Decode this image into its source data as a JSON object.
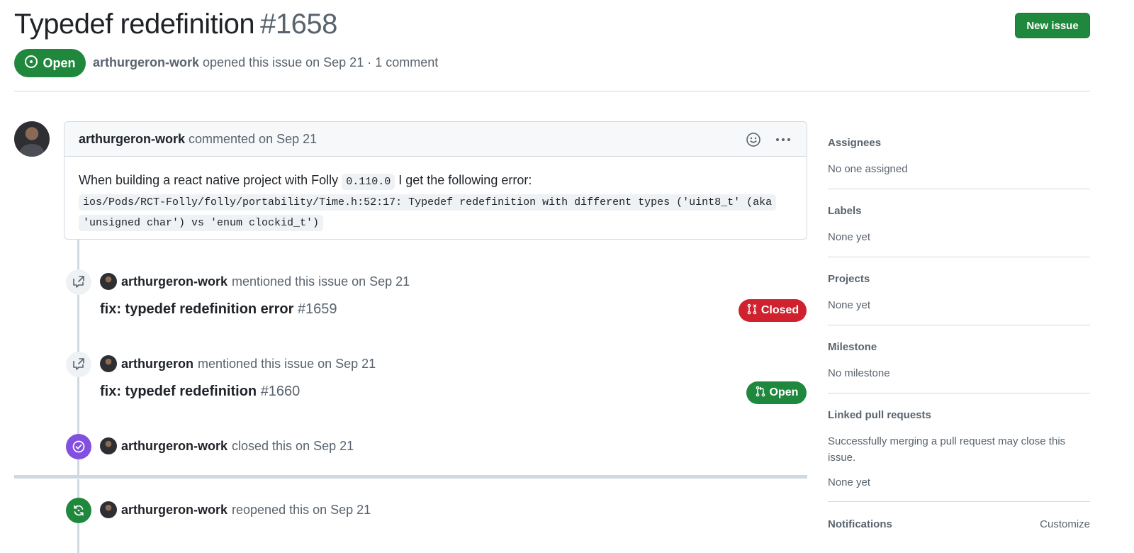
{
  "issue": {
    "title": "Typedef redefinition",
    "number": "#1658",
    "state": "Open",
    "author": "arthurgeron-work",
    "meta": "opened this issue on Sep 21 · 1 comment",
    "new_issue_label": "New issue"
  },
  "comment": {
    "author": "arthurgeron-work",
    "meta": "commented on Sep 21",
    "body_prefix": "When building a react native project with Folly",
    "body_version": "0.110.0",
    "body_suffix": "I get the following error:",
    "error_line1": "ios/Pods/RCT-Folly/folly/portability/Time.h:52:17: Typedef redefinition with different types ('uint8_t' (aka",
    "error_line2": "'unsigned char') vs 'enum clockid_t')"
  },
  "timeline": [
    {
      "actor": "arthurgeron-work",
      "action": "mentioned this issue on Sep 21",
      "ref_title": "fix: typedef redefinition error",
      "ref_number": "#1659",
      "ref_state": "Closed"
    },
    {
      "actor": "arthurgeron",
      "action": "mentioned this issue on Sep 21",
      "ref_title": "fix: typedef redefinition",
      "ref_number": "#1660",
      "ref_state": "Open"
    },
    {
      "actor": "arthurgeron-work",
      "action": "closed this on Sep 21"
    },
    {
      "actor": "arthurgeron-work",
      "action": "reopened this on Sep 21"
    }
  ],
  "sidebar": {
    "assignees": {
      "label": "Assignees",
      "value": "No one assigned"
    },
    "labels": {
      "label": "Labels",
      "value": "None yet"
    },
    "projects": {
      "label": "Projects",
      "value": "None yet"
    },
    "milestone": {
      "label": "Milestone",
      "value": "No milestone"
    },
    "linked_prs": {
      "label": "Linked pull requests",
      "description": "Successfully merging a pull request may close this issue.",
      "value": "None yet"
    },
    "notifications": {
      "label": "Notifications",
      "action": "Customize"
    }
  },
  "colors": {
    "open_green": "#1f883d",
    "closed_red": "#cf222e",
    "merged_purple": "#8250df",
    "muted_text": "#59636e",
    "border": "#d1d9e0"
  }
}
